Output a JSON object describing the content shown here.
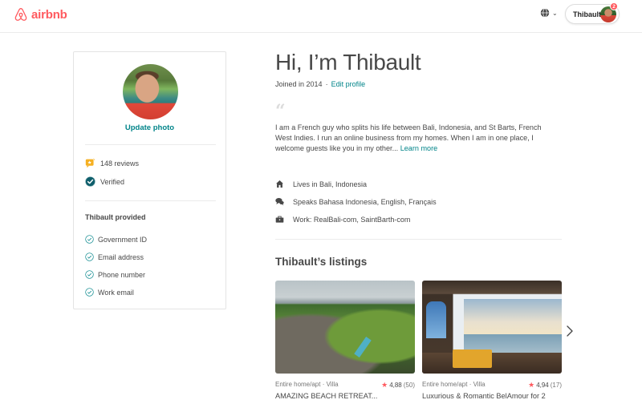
{
  "header": {
    "brand": "airbnb",
    "brand_color": "#ff5a5f",
    "language_icon": "globe-icon",
    "user_name": "Thibault",
    "notification_count": "2"
  },
  "profile_card": {
    "update_photo_label": "Update photo",
    "reviews_label": "148 reviews",
    "verified_label": "Verified",
    "provided_title": "Thibault provided",
    "provided_items": [
      "Government ID",
      "Email address",
      "Phone number",
      "Work email"
    ]
  },
  "main": {
    "greeting": "Hi, I’m Thibault",
    "joined": "Joined in 2014",
    "separator": "·",
    "edit_profile": "Edit profile",
    "quote_mark": "“",
    "bio": "I am a French guy who splits his life between Bali, Indonesia, and St Barts, French West Indies. I run an online business from my homes. When I  am in one place, I welcome guests like you in my other...",
    "learn_more": "Learn more",
    "info": [
      {
        "icon": "home-icon",
        "text": "Lives in Bali, Indonesia"
      },
      {
        "icon": "speech-bubbles-icon",
        "text": "Speaks Bahasa Indonesia, English, Français"
      },
      {
        "icon": "briefcase-icon",
        "text": "Work: RealBali-com, SaintBarth-com"
      }
    ],
    "listings_title": "Thibault’s listings",
    "listings": [
      {
        "type": "Entire home/apt · Villa",
        "rating": "4,88",
        "reviews": "(50)",
        "title": "AMAZING BEACH RETREAT..."
      },
      {
        "type": "Entire home/apt · Villa",
        "rating": "4,94",
        "reviews": "(17)",
        "title": "Luxurious & Romantic BelAmour for 2"
      }
    ],
    "star_glyph": "★"
  },
  "colors": {
    "accent_teal": "#008489",
    "brand_red": "#ff5a5f"
  }
}
